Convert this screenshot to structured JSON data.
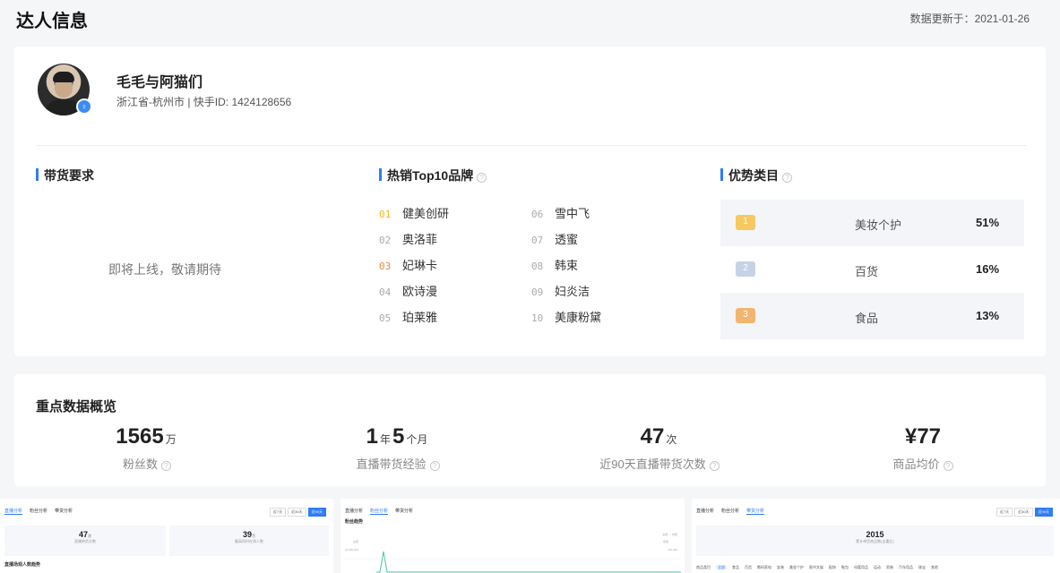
{
  "header": {
    "title": "达人信息",
    "update_label": "数据更新于：2021-01-26"
  },
  "profile": {
    "name": "毛毛与阿猫们",
    "meta": "浙江省-杭州市 | 快手ID: 1424128656"
  },
  "sections": {
    "requirements": {
      "title": "带货要求",
      "content": "即将上线，敬请期待"
    },
    "brands": {
      "title": "热销Top10品牌",
      "items": [
        {
          "rank": "01",
          "name": "健美创研"
        },
        {
          "rank": "02",
          "name": "奥洛菲"
        },
        {
          "rank": "03",
          "name": "妃琳卡"
        },
        {
          "rank": "04",
          "name": "欧诗漫"
        },
        {
          "rank": "05",
          "name": "珀莱雅"
        },
        {
          "rank": "06",
          "name": "雪中飞"
        },
        {
          "rank": "07",
          "name": "透蜜"
        },
        {
          "rank": "08",
          "name": "韩束"
        },
        {
          "rank": "09",
          "name": "妇炎洁"
        },
        {
          "rank": "10",
          "name": "美康粉黛"
        }
      ]
    },
    "categories": {
      "title": "优势类目",
      "items": [
        {
          "rank": "1",
          "name": "美妆个护",
          "percent": "51%"
        },
        {
          "rank": "2",
          "name": "百货",
          "percent": "16%"
        },
        {
          "rank": "3",
          "name": "食品",
          "percent": "13%"
        }
      ]
    }
  },
  "overview": {
    "title": "重点数据概览",
    "stats": [
      {
        "value": "1565",
        "unit": "万",
        "label": "粉丝数"
      },
      {
        "value_a": "1",
        "unit_a": "年",
        "value_b": "5",
        "unit_b": "个月",
        "label": "直播带货经验"
      },
      {
        "value": "47",
        "unit": "次",
        "label": "近90天直播带货次数"
      },
      {
        "prefix": "¥",
        "value": "77",
        "label": "商品均价"
      }
    ]
  },
  "thumbnails": {
    "tabs": [
      "直播分析",
      "粉丝分析",
      "带货分析"
    ],
    "range_buttons": [
      "近7天",
      "近30天",
      "近90天"
    ],
    "live": {
      "stat1_value": "47",
      "stat1_unit": "次",
      "stat1_label": "直播带货次数",
      "stat2_value": "39",
      "stat2_unit": "万",
      "stat2_label": "最高同时在线人数",
      "section": "直播场观人数趋势"
    },
    "fans": {
      "section": "粉丝趋势",
      "legend_a": "总量",
      "legend_b": "增量",
      "axis_left_1": "总量",
      "axis_right_1": "增量",
      "axis_left_2": "20,000,000",
      "axis_right_2": "150,000"
    },
    "goods": {
      "value": "2015",
      "label": "累计带货商品数(去重后)",
      "categories": [
        "商品类目",
        "全部",
        "食品",
        "百货",
        "数码家电",
        "女装",
        "美妆个护",
        "图书文娱",
        "配饰",
        "鞋包",
        "母婴用品",
        "运动",
        "男装",
        "汽车用品",
        "珠宝",
        "其他"
      ]
    }
  }
}
